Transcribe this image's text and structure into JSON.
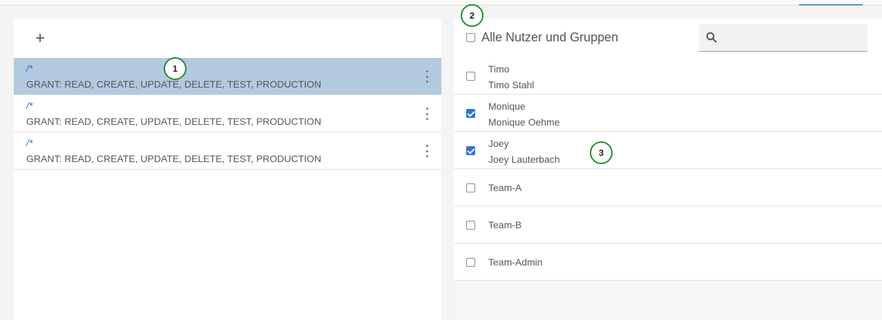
{
  "toolbar": {
    "add_icon": "plus-icon",
    "add_label": "+"
  },
  "rules": [
    {
      "path": "/*",
      "grant": "GRANT: READ, CREATE, UPDATE, DELETE, TEST, PRODUCTION",
      "selected": true
    },
    {
      "path": "/*",
      "grant": "GRANT: READ, CREATE, UPDATE, DELETE, TEST, PRODUCTION",
      "selected": false
    },
    {
      "path": "/*",
      "grant": "GRANT: READ, CREATE, UPDATE, DELETE, TEST, PRODUCTION",
      "selected": false
    }
  ],
  "members": {
    "select_all_label": "Alle Nutzer und Gruppen",
    "search_placeholder": "",
    "items": [
      {
        "line1": "Timo",
        "line2": "Timo Stahl",
        "checked": false
      },
      {
        "line1": "Monique",
        "line2": "Monique Oehme",
        "checked": true
      },
      {
        "line1": "Joey",
        "line2": "Joey Lauterbach",
        "checked": true
      },
      {
        "line1": "Team-A",
        "checked": false
      },
      {
        "line1": "Team-B",
        "checked": false
      },
      {
        "line1": "Team-Admin",
        "checked": false
      }
    ]
  },
  "markers": [
    "1",
    "2",
    "3"
  ],
  "colors": {
    "selected_row": "#b3c9df",
    "checkbox_checked": "#2f74d0",
    "path_text": "#2f6fc0",
    "marker_ring": "#1f8a2a"
  }
}
